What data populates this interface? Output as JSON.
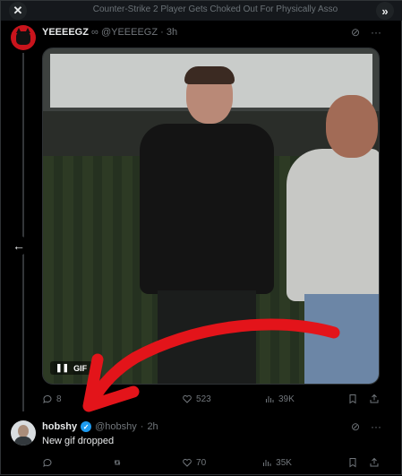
{
  "window": {
    "title": "Counter-Strike 2 Player Gets Choked Out For Physically Asso",
    "close_icon": "close-icon",
    "expand_icon": "chevron-double-right-icon"
  },
  "tweet1": {
    "display_name": "YEEEEGZ",
    "name_badge": "∞",
    "handle": "@YEEEEGZ",
    "sep": "·",
    "time": "3h",
    "gif_label": "GIF",
    "replies": "8",
    "retweets": "",
    "likes": "523",
    "views": "39K"
  },
  "tweet2": {
    "display_name": "hobshy",
    "handle": "@hobshy",
    "sep": "·",
    "time": "2h",
    "text": "New gif dropped",
    "replies": "",
    "retweets": "",
    "likes": "70",
    "views": "35K"
  },
  "colors": {
    "background": "#000000",
    "muted": "#71767b",
    "verified": "#1d9bf0",
    "annotation_arrow": "#e3141a"
  }
}
